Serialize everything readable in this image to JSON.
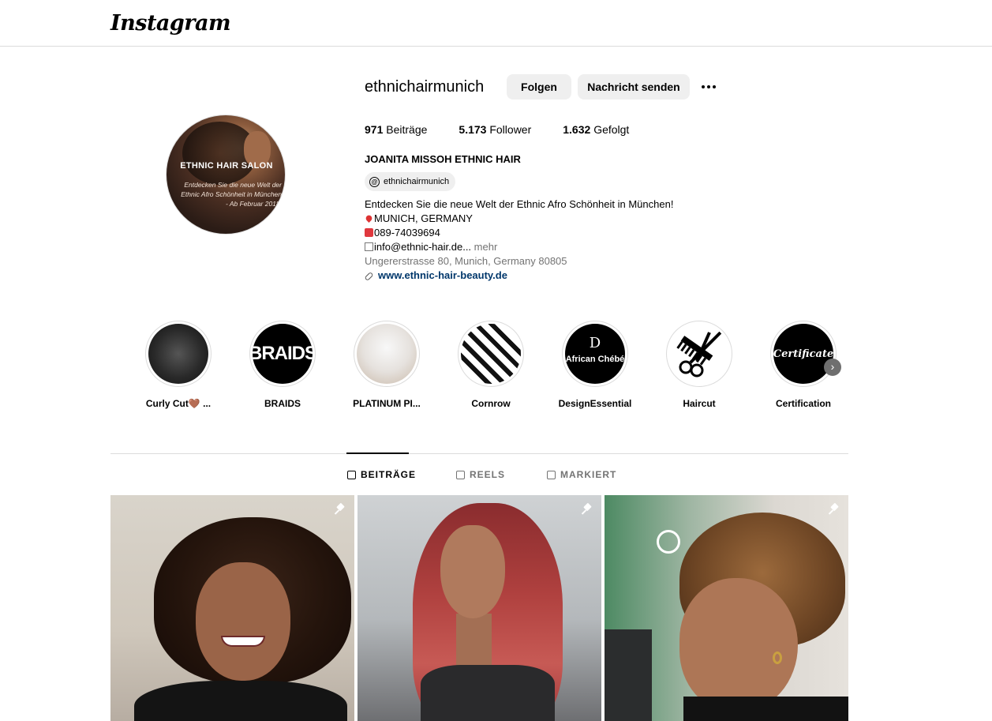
{
  "app": {
    "logo_text": "Instagram"
  },
  "profile": {
    "avatar_title": "ETHNIC HAIR SALON",
    "avatar_subtitle": "Entdecken Sie die neue Welt der Ethnic Afro Schönheit in München - Ab Februar 2018!",
    "username": "ethnichairmunich",
    "follow_label": "Folgen",
    "message_label": "Nachricht senden",
    "more_icon": "more-horizontal-icon",
    "stats": {
      "posts_count": "971",
      "posts_label": "Beiträge",
      "followers_count": "5.173",
      "followers_label": "Follower",
      "following_count": "1.632",
      "following_label": "Gefolgt"
    },
    "full_name": "JOANITA MISSOH ETHNIC HAIR",
    "threads_handle": "ethnichairmunich",
    "bio": {
      "line1": "Entdecken Sie die neue Welt der Ethnic Afro Schönheit in München!",
      "location": "MUNICH, GERMANY",
      "phone": "089-74039694",
      "email": "info@ethnic-hair.de...",
      "more_label": "mehr",
      "address": "Ungererstrasse 80, Munich, Germany 80805",
      "website": "www.ethnic-hair-beauty.de"
    }
  },
  "highlights": [
    {
      "label": "Curly Cut🤎 ..."
    },
    {
      "label": "BRAIDS",
      "cover_text": "BRAIDS"
    },
    {
      "label": "PLATINUM PI..."
    },
    {
      "label": "Cornrow"
    },
    {
      "label": "DesignEssential",
      "cover_text": "African Chébé"
    },
    {
      "label": "Haircut",
      "cover_icon": "scissors-comb-icon"
    },
    {
      "label": "Certification",
      "cover_text": "Certificate"
    }
  ],
  "tabs": [
    {
      "label": "BEITRÄGE",
      "active": true,
      "icon": "grid-icon"
    },
    {
      "label": "REELS",
      "active": false,
      "icon": "reels-icon"
    },
    {
      "label": "MARKIERT",
      "active": false,
      "icon": "tagged-icon"
    }
  ],
  "posts": [
    {
      "pinned": true
    },
    {
      "pinned": true
    },
    {
      "pinned": true
    }
  ],
  "colors": {
    "link": "#00376b",
    "button_bg": "#efefef",
    "muted_text": "#737373",
    "divider": "#dbdbdb"
  }
}
